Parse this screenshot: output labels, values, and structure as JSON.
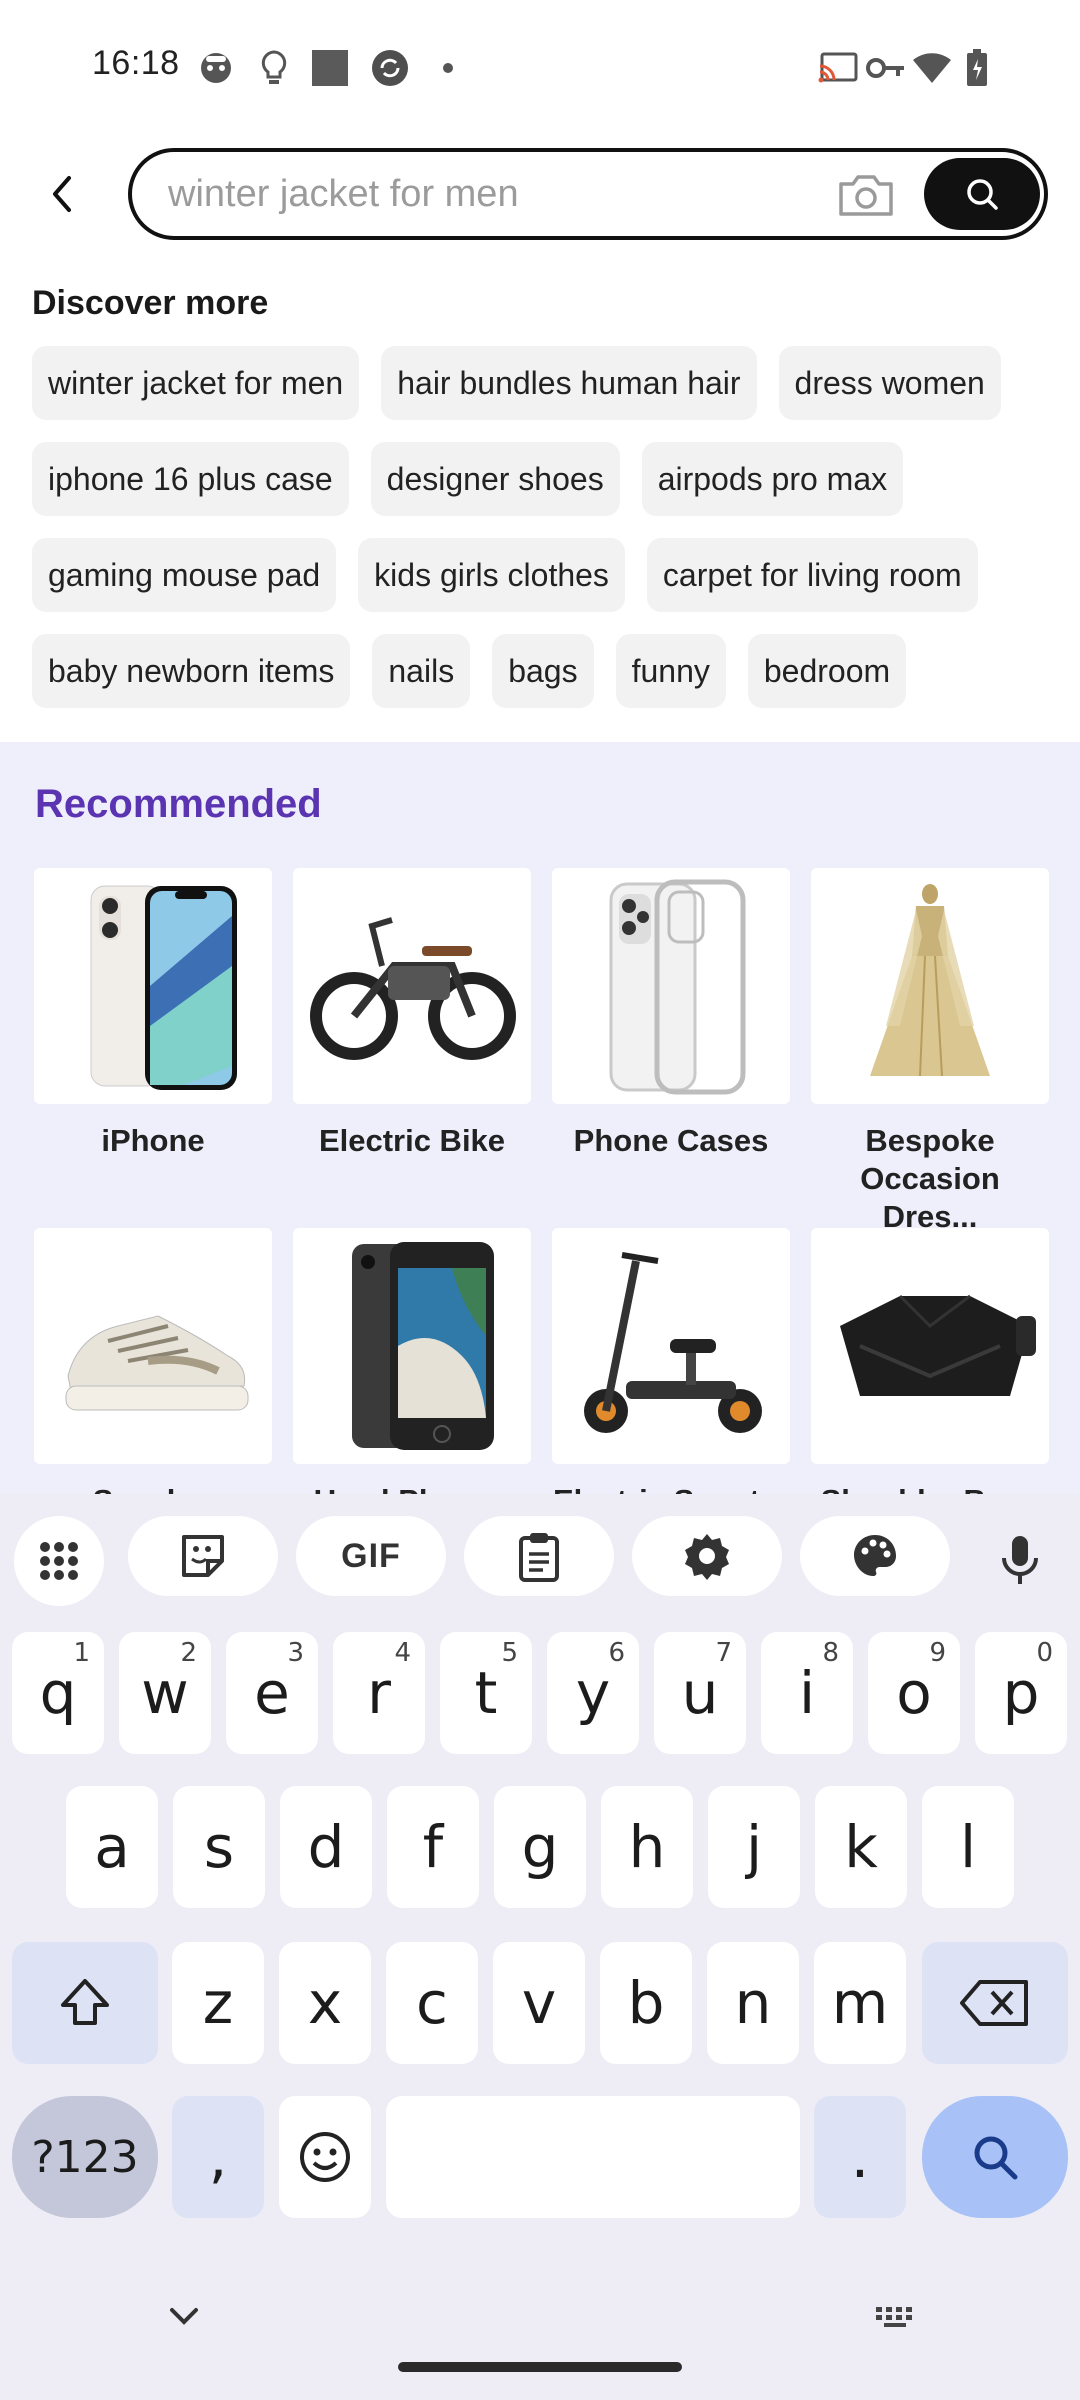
{
  "status_bar": {
    "time": "16:18",
    "left_icons": [
      "face-icon",
      "bulb-icon",
      "square-icon",
      "sync-icon",
      "dot-icon"
    ],
    "right_icons": [
      "cast-icon",
      "key-icon",
      "wifi-icon",
      "battery-icon"
    ]
  },
  "search": {
    "placeholder": "winter jacket for men",
    "value": ""
  },
  "discover": {
    "title": "Discover more",
    "chips": [
      "winter jacket for men",
      "hair bundles human hair",
      "dress women",
      "iphone 16 plus case",
      "designer shoes",
      "airpods pro max",
      "gaming mouse pad",
      "kids girls clothes",
      "carpet for living room",
      "baby newborn items",
      "nails",
      "bags",
      "funny",
      "bedroom"
    ]
  },
  "recommended": {
    "title": "Recommended",
    "items": [
      {
        "label": "iPhone",
        "icon": "iphone-image"
      },
      {
        "label": "Electric Bike",
        "icon": "electric-bike-image"
      },
      {
        "label": "Phone Cases",
        "icon": "phone-case-image"
      },
      {
        "label": "Bespoke Occasion Dres...",
        "icon": "gown-image"
      },
      {
        "label": "Sneaker",
        "icon": "sneaker-image"
      },
      {
        "label": "Used Phones",
        "icon": "used-phone-image"
      },
      {
        "label": "Electric Scooter",
        "icon": "scooter-image"
      },
      {
        "label": "Shoulder Bags",
        "icon": "shoulder-bag-image"
      }
    ]
  },
  "keyboard": {
    "toolbar": {
      "apps": "apps-grid-icon",
      "sticker": "sticker-icon",
      "gif": "GIF",
      "clipboard": "clipboard-icon",
      "settings": "gear-icon",
      "theme": "palette-icon",
      "mic": "mic-icon"
    },
    "row1": [
      {
        "k": "q",
        "h": "1"
      },
      {
        "k": "w",
        "h": "2"
      },
      {
        "k": "e",
        "h": "3"
      },
      {
        "k": "r",
        "h": "4"
      },
      {
        "k": "t",
        "h": "5"
      },
      {
        "k": "y",
        "h": "6"
      },
      {
        "k": "u",
        "h": "7"
      },
      {
        "k": "i",
        "h": "8"
      },
      {
        "k": "o",
        "h": "9"
      },
      {
        "k": "p",
        "h": "0"
      }
    ],
    "row2": [
      "a",
      "s",
      "d",
      "f",
      "g",
      "h",
      "j",
      "k",
      "l"
    ],
    "row3": [
      "z",
      "x",
      "c",
      "v",
      "b",
      "n",
      "m"
    ],
    "symbols_label": "?123",
    "comma": ",",
    "period": "."
  },
  "colors": {
    "accent": "#5b34b2",
    "recommended_bg": "#efeefb",
    "keyboard_bg": "#eeedf6",
    "search_key": "#a8c2f7"
  }
}
